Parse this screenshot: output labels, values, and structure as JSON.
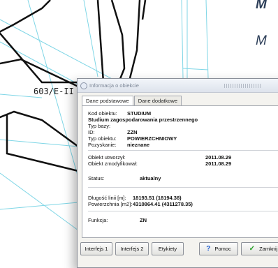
{
  "side_text": [
    "M",
    "M"
  ],
  "map": {
    "parcel_label": "603/E-II"
  },
  "dialog": {
    "title": "Informacja o obiekcie",
    "tabs": [
      {
        "label": "Dane podstawowe"
      },
      {
        "label": "Dane dodatkowe"
      }
    ],
    "fields": {
      "kod_label": "Kod obiektu:",
      "kod_value": "STUDIUM",
      "description": "Studium zagospodarowania przestrzennego",
      "typ_bazy_label": "Typ bazy:",
      "id_label": "ID:",
      "id_value": "ZZN",
      "typ_obiektu_label": "Typ obiektu:",
      "typ_obiektu_value": "POWIERZCHNIOWY",
      "pozyskanie_label": "Pozyskanie:",
      "pozyskanie_value": "nieznane",
      "utworzyl_label": "Obiekt utworzył:",
      "utworzyl_value": "2011.08.29",
      "zmodyfikowal_label": "Obiekt zmodyfikował:",
      "zmodyfikowal_value": "2011.08.29",
      "status_label": "Status:",
      "status_value": "aktualny",
      "dlugosc_label": "Długość linii [m]:",
      "dlugosc_value": "18193.51 (18194.38)",
      "powierzchnia_label": "Powierzchnia [m2]:",
      "powierzchnia_value": "4310864.41 (4311278.35)",
      "funkcja_label": "Funkcja:",
      "funkcja_value": "ZN"
    },
    "buttons": {
      "interfejs1": "Interfejs 1",
      "interfejs2": "Interfejs 2",
      "etykiety": "Etykiety",
      "pomoc": "Pomoc",
      "zamknij": "Zamknij"
    }
  },
  "colors": {
    "map_line": "#111111",
    "map_cyan": "#7fd6e6",
    "help_icon": "#1f5fd0",
    "close_icon": "#1e9d1e"
  }
}
